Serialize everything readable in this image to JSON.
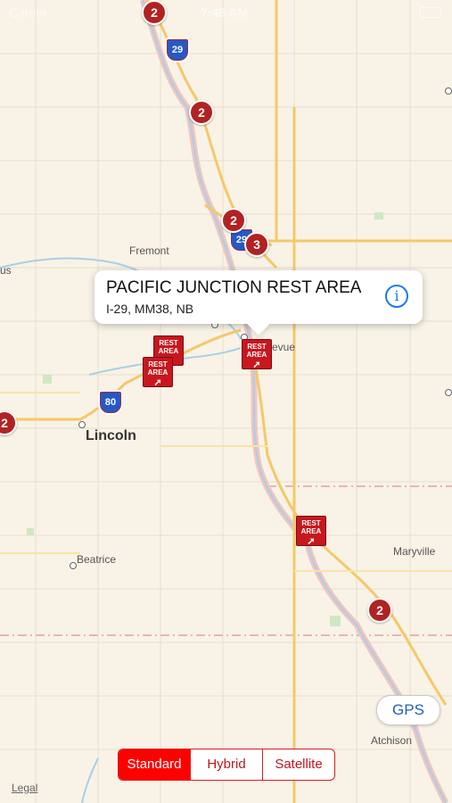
{
  "status_bar": {
    "carrier": "Carrier",
    "time": "7:48 AM"
  },
  "map": {
    "cities": [
      "Fremont",
      "Lincoln",
      "Bellevue",
      "Beatrice",
      "Maryville",
      "Atchison",
      "us"
    ],
    "clusters": [
      "2",
      "2",
      "2",
      "3",
      "2",
      "2"
    ],
    "rest_area_label": "REST AREA",
    "interstates": [
      "29",
      "29",
      "80"
    ]
  },
  "callout": {
    "title": "PACIFIC JUNCTION REST AREA",
    "subtitle": "I-29,  MM38, NB"
  },
  "gps_button": "GPS",
  "map_type": {
    "options": [
      "Standard",
      "Hybrid",
      "Satellite"
    ],
    "selected": "Standard"
  },
  "legal": "Legal",
  "colors": {
    "accent": "#ff0000",
    "cluster": "#b22222",
    "info": "#1a7be8"
  }
}
